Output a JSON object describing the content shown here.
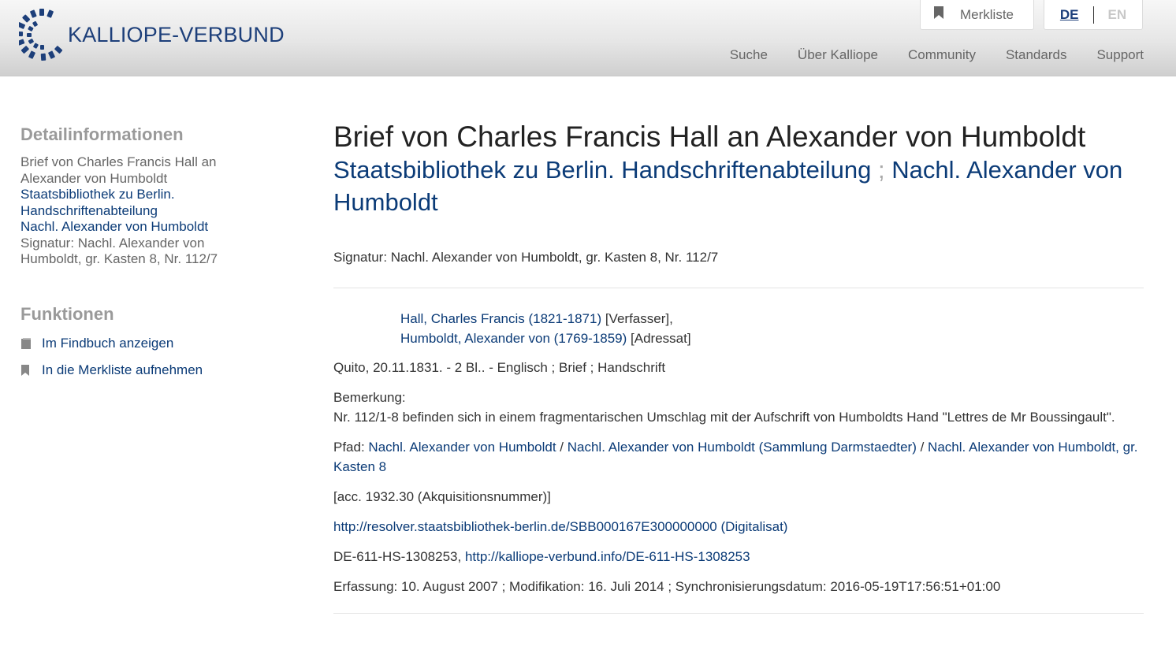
{
  "header": {
    "logo_text": "KALLIOPE-VERBUND",
    "merkliste_label": "Merkliste",
    "lang_de": "DE",
    "lang_en": "EN",
    "nav": [
      "Suche",
      "Über Kalliope",
      "Community",
      "Standards",
      "Support"
    ]
  },
  "sidebar": {
    "detail_heading": "Detailinformationen",
    "detail_title": "Brief von Charles Francis Hall an Alexander von Humboldt",
    "link_institution": "Staatsbibliothek zu Berlin. Handschriftenabteilung",
    "link_nachlass": "Nachl. Alexander von Humboldt",
    "signatur": "Signatur: Nachl. Alexander von Humboldt, gr. Kasten 8, Nr. 112/7",
    "functions_heading": "Funktionen",
    "func_findbuch": "Im Findbuch anzeigen",
    "func_merkliste": "In die Merkliste aufnehmen"
  },
  "main": {
    "title": "Brief von Charles Francis Hall an Alexander von Humboldt",
    "subtitle_link1": "Staatsbibliothek zu Berlin. Handschriftenabteilung",
    "subtitle_sep": ";",
    "subtitle_link2": "Nachl. Alexander von Humboldt",
    "signatur": "Signatur: Nachl. Alexander von Humboldt, gr. Kasten 8, Nr. 112/7",
    "person1_link": "Hall, Charles Francis (1821-1871)",
    "person1_role": " [Verfasser],",
    "person2_link": "Humboldt, Alexander von (1769-1859)",
    "person2_role": " [Adressat]",
    "description": "Quito, 20.11.1831. - 2 Bl.. - Englisch ; Brief ; Handschrift",
    "remark_label": "Bemerkung:",
    "remark_text": "Nr. 112/1-8 befinden sich in einem fragmentarischen Umschlag mit der Aufschrift von Humboldts Hand \"Lettres de Mr Boussingault\".",
    "path_label": "Pfad: ",
    "path_links": [
      "Nachl. Alexander von Humboldt",
      "Nachl. Alexander von Humboldt (Sammlung Darmstaedter)",
      "Nachl. Alexander von Humboldt, gr. Kasten 8"
    ],
    "path_sep": " / ",
    "acc": "[acc. 1932.30 (Akquisitionsnummer)]",
    "digitalisat_link": "http://resolver.staatsbibliothek-berlin.de/SBB000167E300000000 (Digitalisat)",
    "id_prefix": "DE-611-HS-1308253, ",
    "id_link": "http://kalliope-verbund.info/DE-611-HS-1308253",
    "dates": "Erfassung: 10. August 2007 ; Modifikation: 16. Juli 2014 ; Synchronisierungsdatum: 2016-05-19T17:56:51+01:00"
  },
  "colors": {
    "brand": "#1d3f7a",
    "link": "#0b3b77",
    "muted": "#9a9a9a"
  }
}
